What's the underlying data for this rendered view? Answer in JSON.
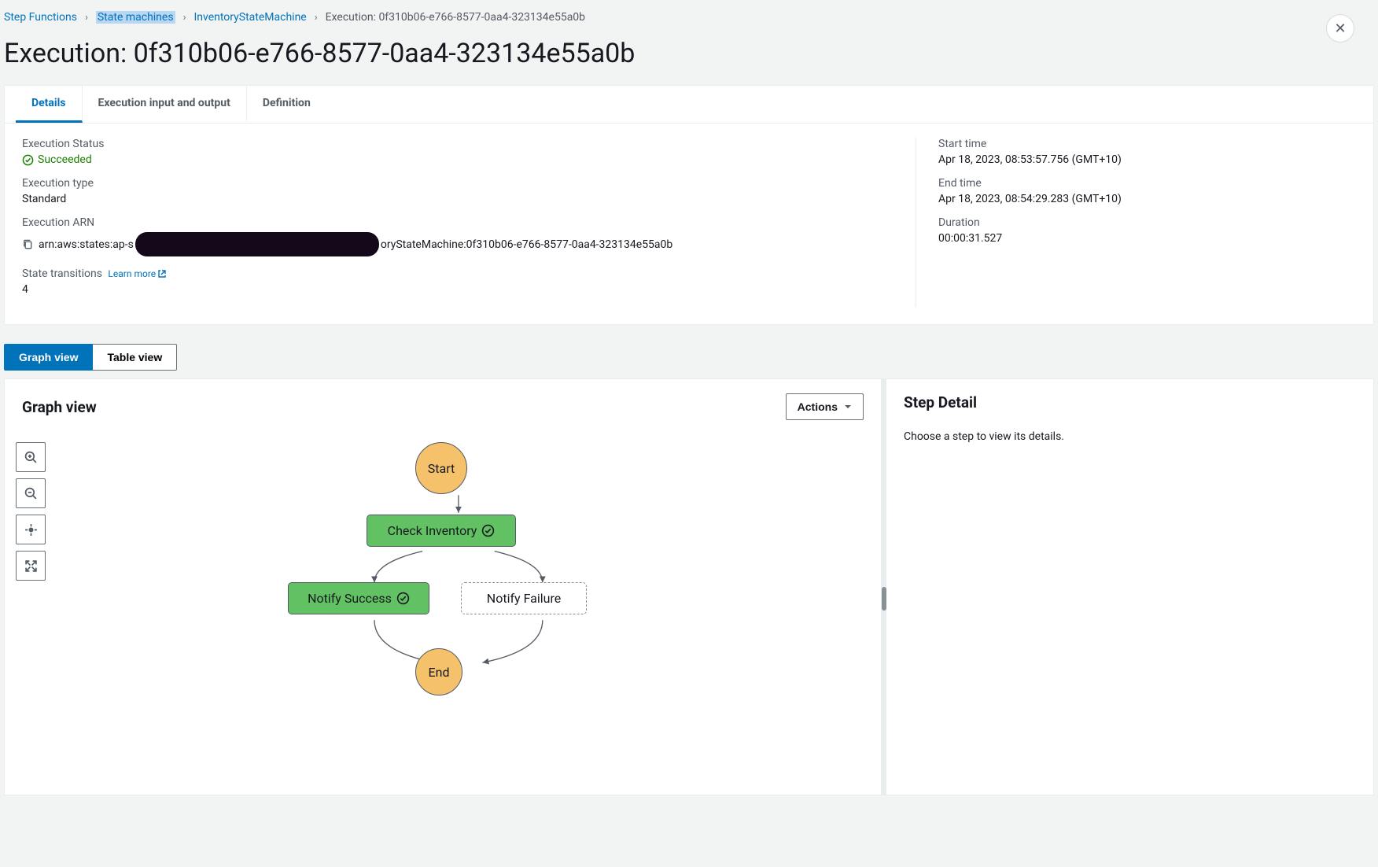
{
  "breadcrumb": {
    "root": "Step Functions",
    "state_machines": "State machines",
    "machine": "InventoryStateMachine",
    "execution": "Execution: 0f310b06-e766-8577-0aa4-323134e55a0b"
  },
  "title": "Execution: 0f310b06-e766-8577-0aa4-323134e55a0b",
  "tabs": {
    "details": "Details",
    "io": "Execution input and output",
    "definition": "Definition"
  },
  "details": {
    "status_label": "Execution Status",
    "status_value": "Succeeded",
    "type_label": "Execution type",
    "type_value": "Standard",
    "arn_label": "Execution ARN",
    "arn_prefix": "arn:aws:states:ap-s",
    "arn_suffix": "oryStateMachine:0f310b06-e766-8577-0aa4-323134e55a0b",
    "transitions_label": "State transitions",
    "learn_more": "Learn more",
    "transitions_value": "4",
    "start_label": "Start time",
    "start_value": "Apr 18, 2023, 08:53:57.756 (GMT+10)",
    "end_label": "End time",
    "end_value": "Apr 18, 2023, 08:54:29.283 (GMT+10)",
    "duration_label": "Duration",
    "duration_value": "00:00:31.527"
  },
  "toggle": {
    "graph": "Graph view",
    "table": "Table view"
  },
  "graph": {
    "title": "Graph view",
    "actions": "Actions",
    "nodes": {
      "start": "Start",
      "check": "Check Inventory",
      "success": "Notify Success",
      "failure": "Notify Failure",
      "end": "End"
    }
  },
  "stepdetail": {
    "title": "Step Detail",
    "empty": "Choose a step to view its details."
  }
}
